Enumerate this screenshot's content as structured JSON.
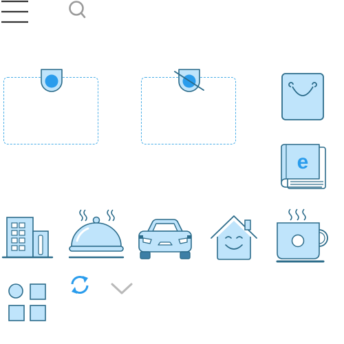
{
  "icons": {
    "menu": "menu-icon",
    "search": "search-icon",
    "visible_marker": "visibility-pin-icon",
    "hidden_marker": "visibility-off-pin-icon",
    "shopping_bag": "shopping-bag-icon",
    "ebook": "ebook-icon",
    "hotel": "hotel-building-icon",
    "food_service": "food-service-cloche-icon",
    "car": "car-icon",
    "home": "smiling-house-icon",
    "coffee": "hot-coffee-cup-icon",
    "apps": "apps-grid-icon",
    "refresh": "refresh-icon",
    "chevron": "chevron-down-icon"
  },
  "ebook_glyph": "e",
  "colors": {
    "accent_blue": "#2a9cec",
    "fill_light": "#bfe4fb",
    "stroke_dark": "#2b6b8a",
    "dashed_border": "#4aaee8",
    "gray": "#9a9a9a"
  }
}
